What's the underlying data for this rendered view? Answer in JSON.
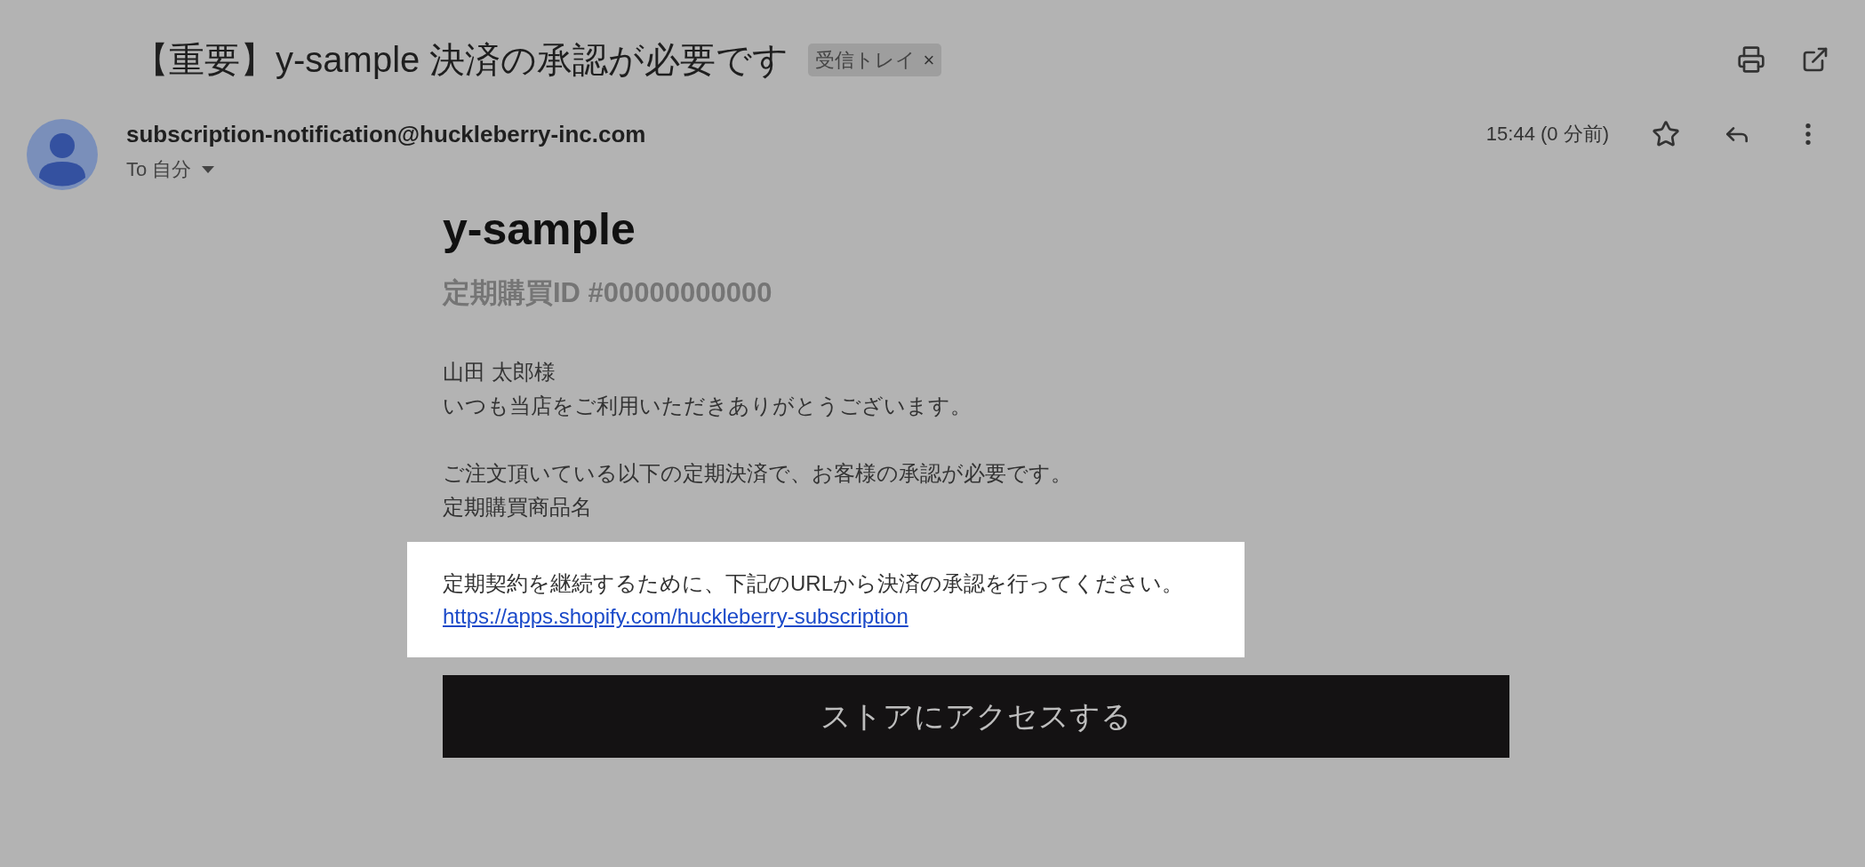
{
  "subject": "【重要】y-sample 決済の承認が必要です",
  "label": {
    "text": "受信トレイ",
    "close": "×"
  },
  "sender": "subscription-notification@huckleberry-inc.com",
  "recipient": "To 自分",
  "time": "15:44 (0 分前)",
  "starred": false,
  "body": {
    "brand": "y-sample",
    "subscription_id": "定期購買ID #00000000000",
    "groups": [
      [
        "山田 太郎様",
        "いつも当店をご利用いただきありがとうございます。"
      ],
      [
        "ご注文頂いている以下の定期決済で、お客様の承認が必要です。",
        "定期購買商品名"
      ]
    ],
    "highlight": {
      "text": "定期契約を継続するために、下記のURLから決済の承認を行ってください。",
      "link": "https://apps.shopify.com/huckleberry-subscription"
    },
    "button": "ストアにアクセスする"
  }
}
